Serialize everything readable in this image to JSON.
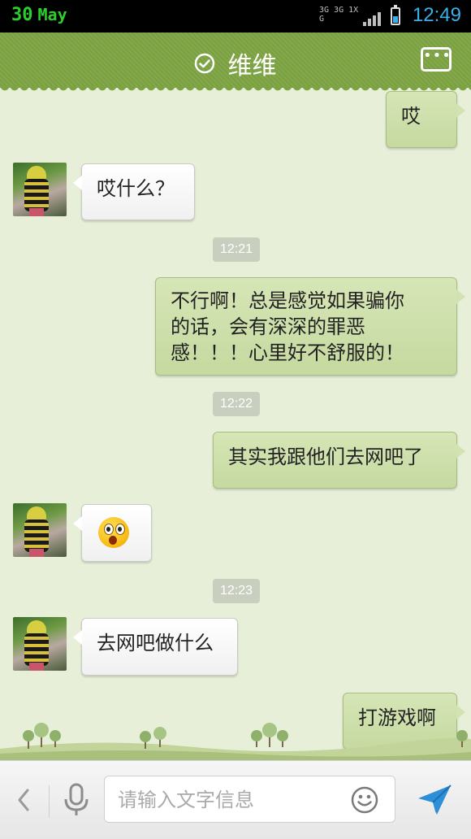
{
  "status": {
    "day": "30",
    "month": "May",
    "network": "3G 3G 1X G",
    "time": "12:49"
  },
  "header": {
    "title": "维维"
  },
  "messages": [
    {
      "text": "哎"
    },
    {
      "text": "哎什么？"
    },
    {
      "time": "12:21"
    },
    {
      "line1": "不行啊！总是感觉如果骗你",
      "line2": "的话，会有深深的罪恶",
      "line3": "感！！！心里好不舒服的！"
    },
    {
      "time": "12:22"
    },
    {
      "text": "其实我跟他们去网吧了"
    },
    {
      "emoji": "surprised-emoji"
    },
    {
      "time": "12:23"
    },
    {
      "text": "去网吧做什么"
    },
    {
      "text": "打游戏啊"
    }
  ],
  "input": {
    "placeholder": "请输入文字信息"
  },
  "colors": {
    "header": "#7da443",
    "background": "#e7efd9",
    "outgoing_bubble": "#cfe0ad",
    "incoming_bubble": "#ffffff",
    "send": "#2d8fd8"
  },
  "icons": [
    "check-circle-icon",
    "more-icon",
    "back-chevron-icon",
    "mic-icon",
    "smiley-icon",
    "send-icon"
  ]
}
